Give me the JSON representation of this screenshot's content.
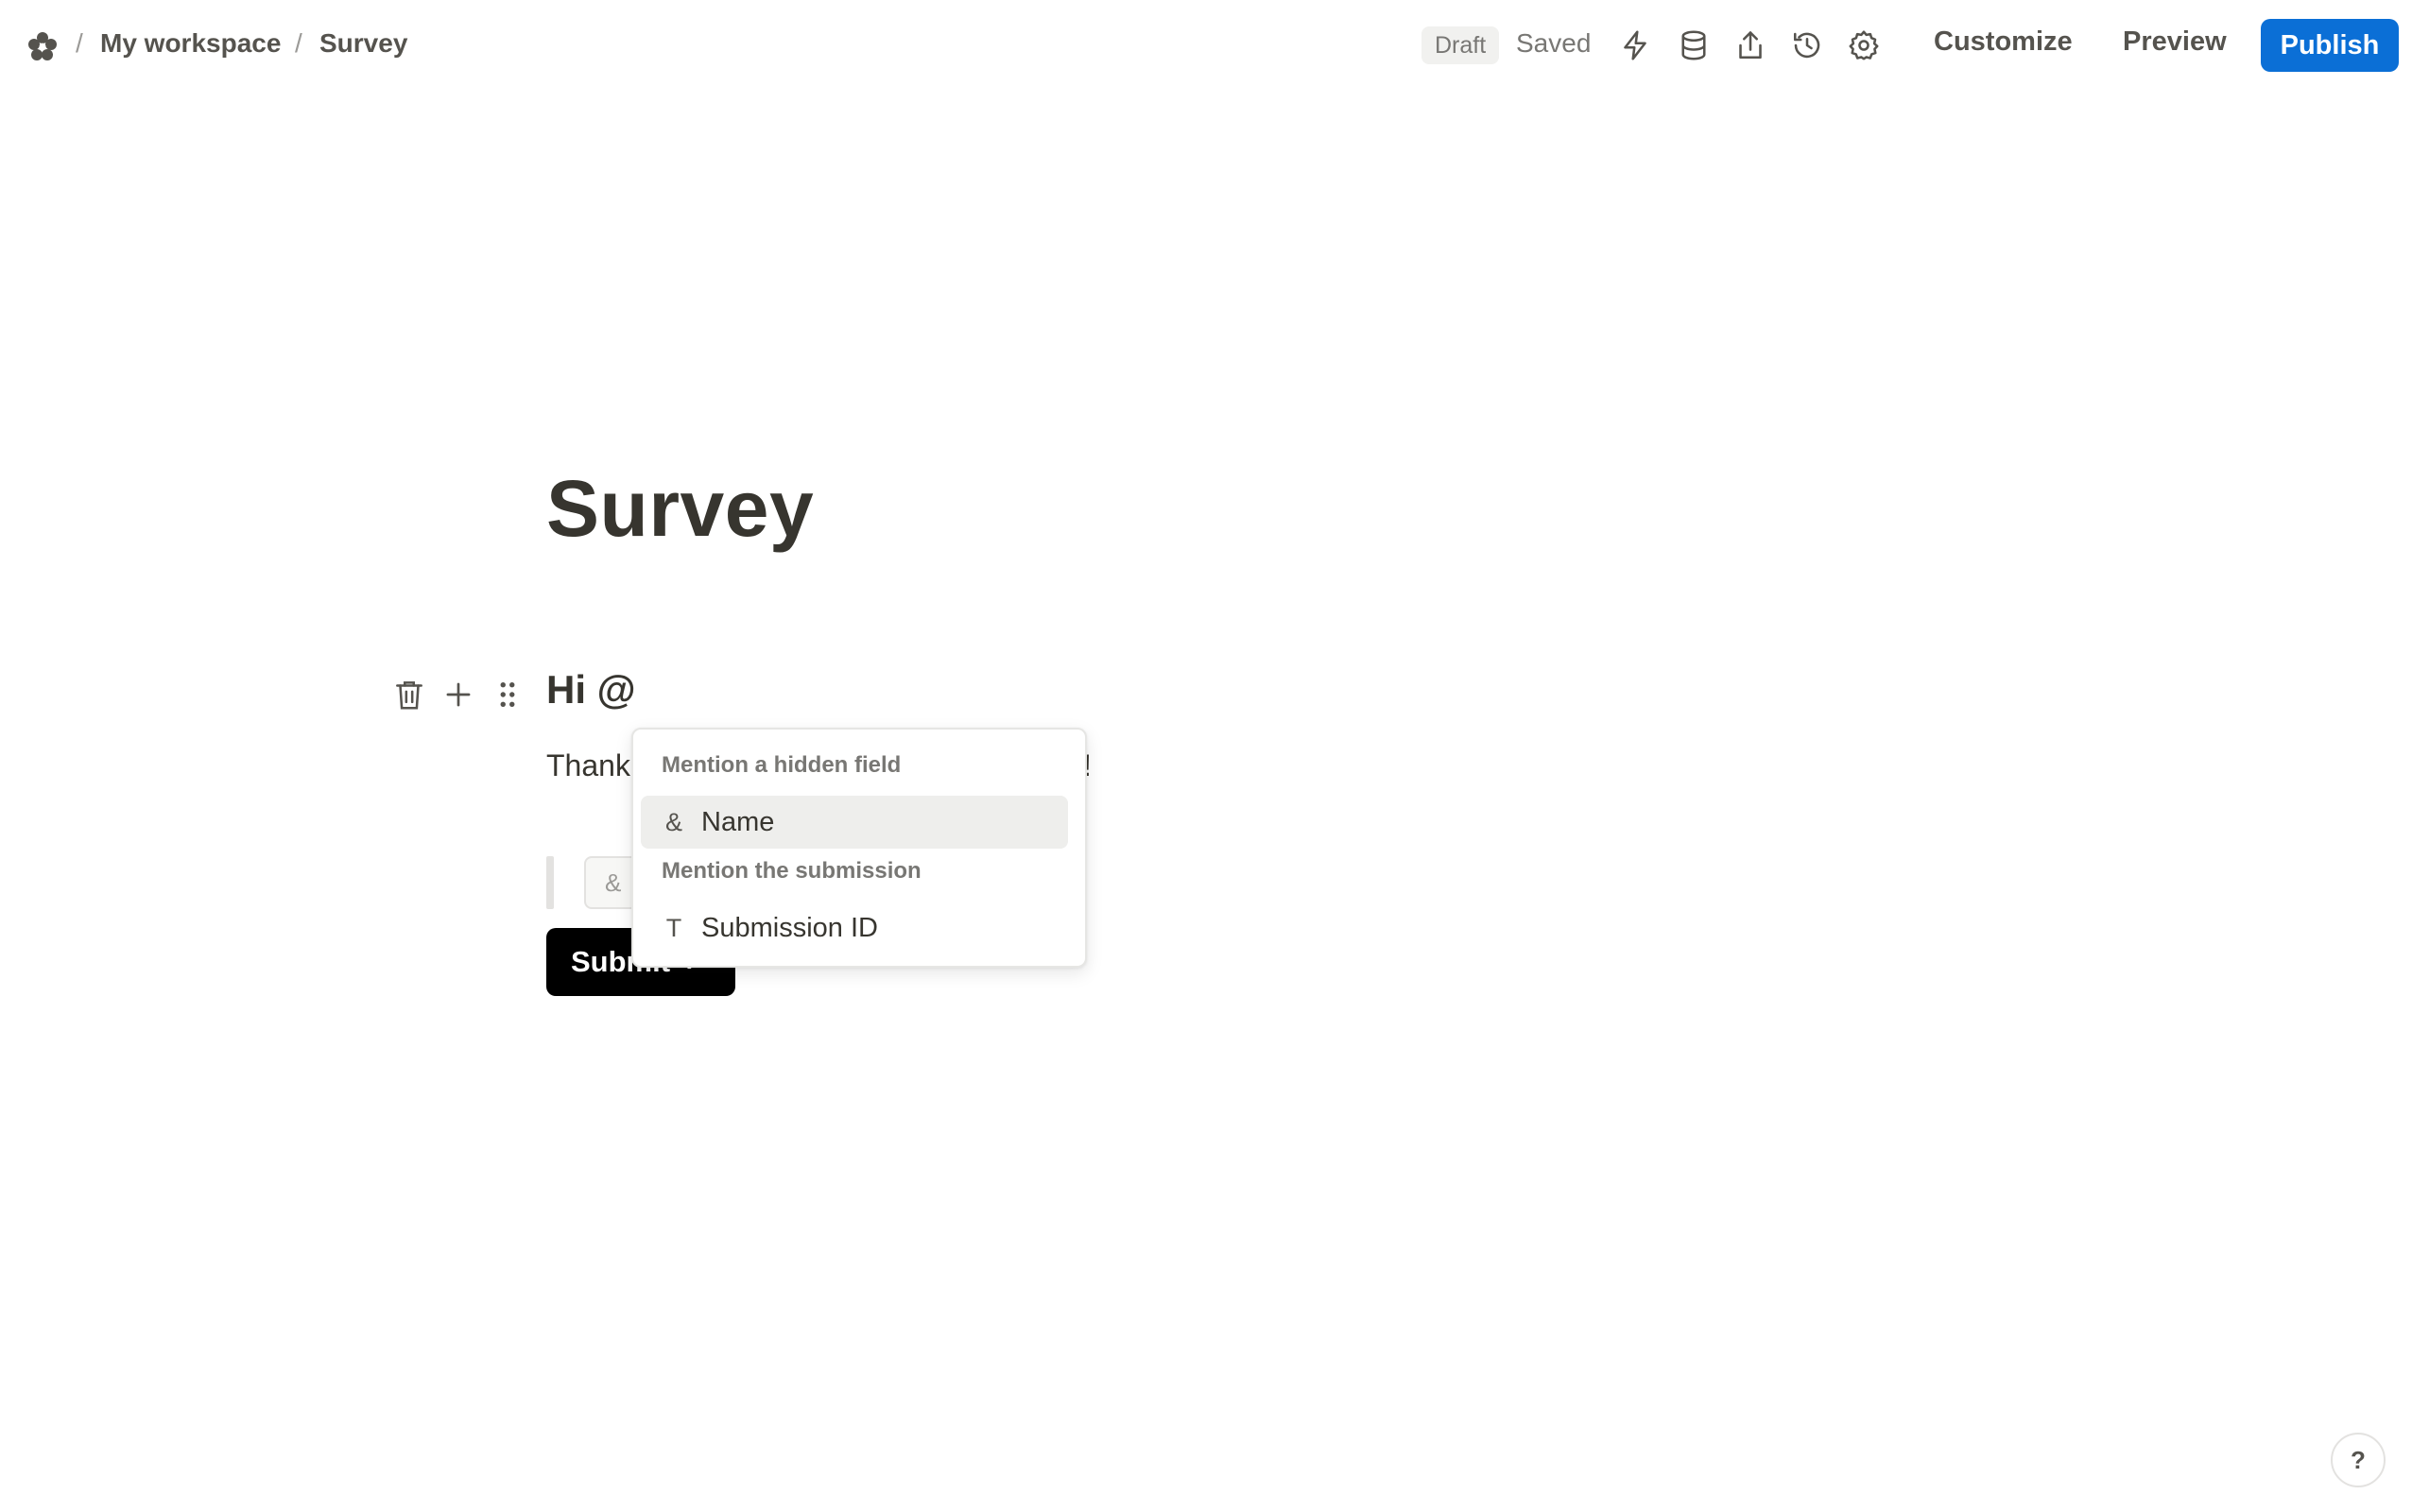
{
  "breadcrumb": {
    "separator": "/",
    "workspace": "My workspace",
    "page": "Survey"
  },
  "status": {
    "badge": "Draft",
    "saved": "Saved"
  },
  "toolbar": {
    "icons": [
      "lightning-icon",
      "database-icon",
      "share-icon",
      "history-icon",
      "gear-icon"
    ],
    "customize_label": "Customize",
    "preview_label": "Preview",
    "publish_label": "Publish",
    "accent_color": "#0b6fd6"
  },
  "form": {
    "title": "Survey",
    "heading": "Hi @",
    "body_text_start": "Thank",
    "body_text_end": "!",
    "input_placeholder": "&",
    "submit_label": "Submit",
    "submit_arrow": "›"
  },
  "block_tools": [
    "trash-icon",
    "plus-icon",
    "drag-handle-icon"
  ],
  "mention_menu": {
    "section_hidden": "Mention a hidden field",
    "hidden_items": [
      {
        "icon": "&",
        "label": "Name",
        "active": true
      }
    ],
    "section_submission": "Mention the submission",
    "submission_items": [
      {
        "icon": "T",
        "label": "Submission ID",
        "active": false
      }
    ]
  },
  "help": {
    "label": "?"
  }
}
